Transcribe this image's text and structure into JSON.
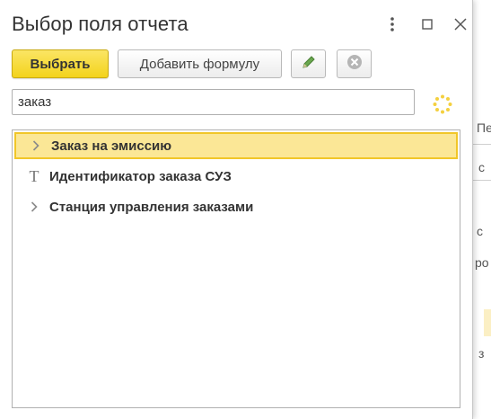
{
  "window": {
    "title": "Выбор поля отчета"
  },
  "toolbar": {
    "select_label": "Выбрать",
    "add_formula_label": "Добавить формулу"
  },
  "search": {
    "value": "заказ"
  },
  "tree": {
    "items": [
      {
        "label": "Заказ на эмиссию",
        "icon": "chevron-right-icon",
        "selected": true
      },
      {
        "label": "Идентификатор заказа СУЗ",
        "icon": "text-type-icon",
        "selected": false
      },
      {
        "label": "Станция управления заказами",
        "icon": "chevron-right-icon",
        "selected": false
      }
    ]
  },
  "background": {
    "fragments": [
      "Пе",
      "с",
      "ро",
      "з"
    ]
  },
  "colors": {
    "primary_button": "#f3d31c",
    "selection": "#fbe796",
    "selection_border": "#f1c628"
  }
}
